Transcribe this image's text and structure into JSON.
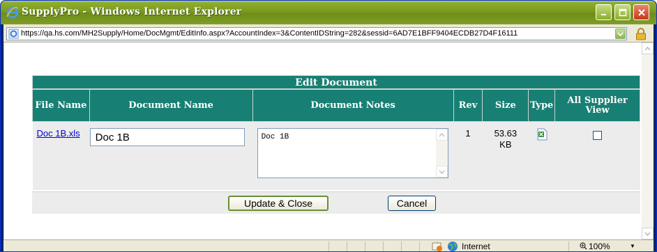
{
  "window": {
    "title": "SupplyPro - Windows Internet Explorer",
    "url": "https://qa.hs.com/MH2Supply/Home/DocMgmt/EditInfo.aspx?AccountIndex=3&ContentIDString=282&sessid=6AD7E1BFF9404ECDB27D4F16111"
  },
  "panel": {
    "title": "Edit Document",
    "columns": [
      "File Name",
      "Document Name",
      "Document Notes",
      "Rev",
      "Size",
      "Type",
      "All Supplier View"
    ],
    "row": {
      "file_name": "Doc 1B.xls",
      "document_name": "Doc 1B",
      "document_notes": "Doc 1B",
      "rev": "1",
      "size": "53.63 KB",
      "type_icon": "excel-file-icon",
      "all_supplier_view": false
    }
  },
  "actions": {
    "update_label": "Update & Close",
    "cancel_label": "Cancel"
  },
  "statusbar": {
    "zone": "Internet",
    "zoom": "100%"
  },
  "colors": {
    "header_teal": "#187f74",
    "row_gray": "#ececec",
    "titlebar_olive": "#7b9a1f"
  }
}
